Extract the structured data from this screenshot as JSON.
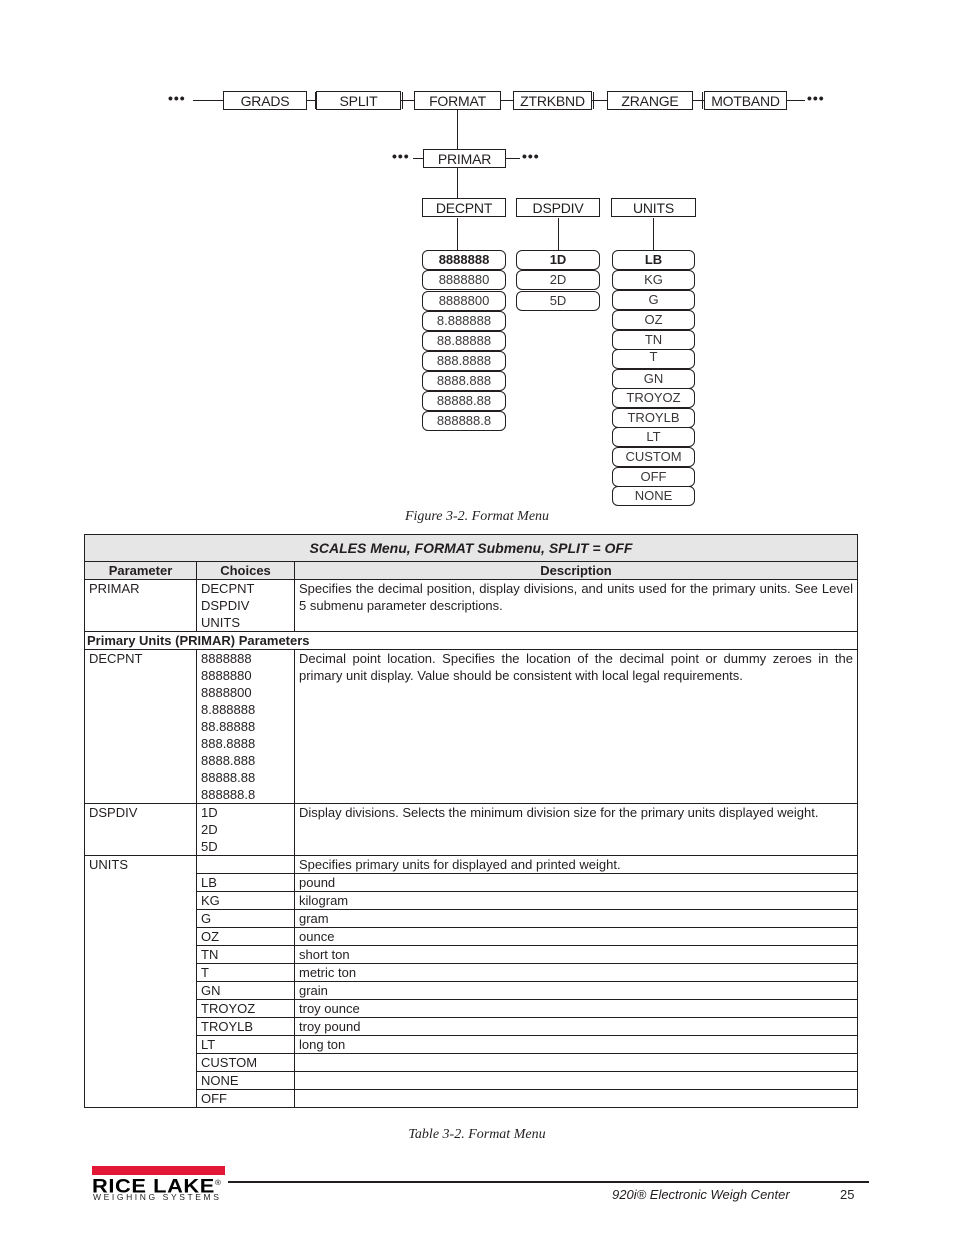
{
  "diagram": {
    "top_row": [
      "GRADS",
      "SPLIT",
      "FORMAT",
      "ZTRKBND",
      "ZRANGE",
      "MOTBAND"
    ],
    "continuation": "•••",
    "primar": "PRIMAR",
    "sub_params": [
      "DECPNT",
      "DSPDIV",
      "UNITS"
    ],
    "decpnt_options": [
      "8888888",
      "8888880",
      "8888800",
      "8.888888",
      "88.88888",
      "888.8888",
      "8888.888",
      "88888.88",
      "888888.8"
    ],
    "dspdiv_options": [
      "1D",
      "2D",
      "5D"
    ],
    "units_options": [
      "LB",
      "KG",
      "G",
      "OZ",
      "TN",
      "T",
      "GN",
      "TROYOZ",
      "TROYLB",
      "LT",
      "CUSTOM",
      "OFF",
      "NONE"
    ],
    "defaults": {
      "decpnt": "8888888",
      "dspdiv": "1D",
      "units": "LB"
    }
  },
  "figure_caption": "Figure 3-2. Format Menu",
  "table": {
    "title": "SCALES Menu, FORMAT Submenu, SPLIT = OFF",
    "headers": [
      "Parameter",
      "Choices",
      "Description"
    ],
    "primar_row": {
      "parameter": "PRIMAR",
      "choices": [
        "DECPNT",
        "DSPDIV",
        "UNITS"
      ],
      "description": "Specifies the decimal position, display divisions, and units used for the primary units. See Level 5 submenu parameter descriptions."
    },
    "section_label": "Primary Units (PRIMAR) Parameters",
    "decpnt_row": {
      "parameter": "DECPNT",
      "choices": [
        "8888888",
        "8888880",
        "8888800",
        "8.888888",
        "88.88888",
        "888.8888",
        "8888.888",
        "88888.88",
        "888888.8"
      ],
      "description": "Decimal point location. Specifies the location of the decimal point or dummy zeroes in the primary unit display. Value should be consistent with local legal requirements."
    },
    "dspdiv_row": {
      "parameter": "DSPDIV",
      "choices": [
        "1D",
        "2D",
        "5D"
      ],
      "description": "Display divisions. Selects the minimum division size for the primary units displayed weight."
    },
    "units_row": {
      "parameter": "UNITS",
      "description": "Specifies primary units for displayed and printed weight.",
      "items": [
        {
          "choice": "LB",
          "meaning": "pound"
        },
        {
          "choice": "KG",
          "meaning": "kilogram"
        },
        {
          "choice": "G",
          "meaning": "gram"
        },
        {
          "choice": "OZ",
          "meaning": "ounce"
        },
        {
          "choice": "TN",
          "meaning": "short ton"
        },
        {
          "choice": "T",
          "meaning": "metric ton"
        },
        {
          "choice": "GN",
          "meaning": "grain"
        },
        {
          "choice": "TROYOZ",
          "meaning": "troy ounce"
        },
        {
          "choice": "TROYLB",
          "meaning": "troy pound"
        },
        {
          "choice": "LT",
          "meaning": "long ton"
        },
        {
          "choice": "CUSTOM",
          "meaning": ""
        },
        {
          "choice": "NONE",
          "meaning": ""
        },
        {
          "choice": "OFF",
          "meaning": ""
        }
      ]
    }
  },
  "table_caption": "Table 3-2. Format Menu",
  "footer": {
    "logo_word": "RICE LAKE",
    "logo_sub": "WEIGHING SYSTEMS",
    "logo_mark": "®",
    "doc_title": "920i® Electronic Weigh Center",
    "page_number": "25",
    "brand_color": "#e31837"
  }
}
